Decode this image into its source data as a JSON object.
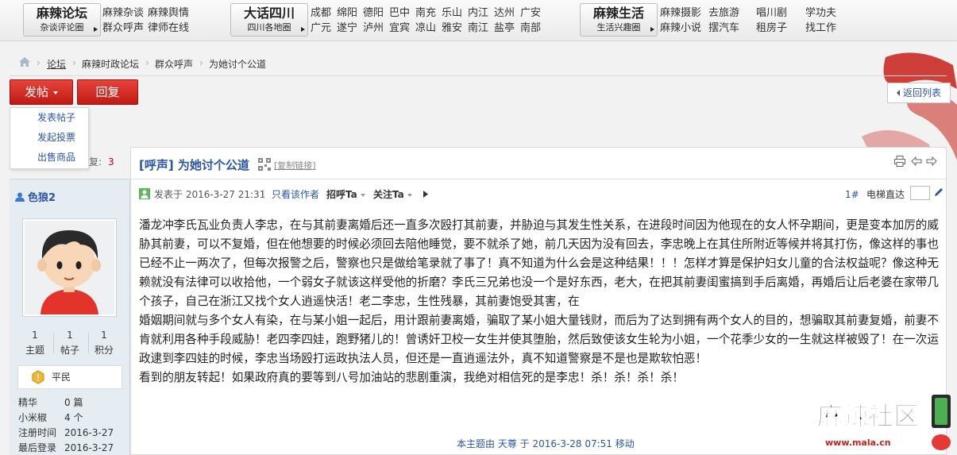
{
  "topnav": {
    "groups": [
      {
        "title": "麻辣论坛",
        "subtitle": "杂谈评论圈"
      },
      {
        "title": "大话四川",
        "subtitle": "四川各地圈"
      },
      {
        "title": "麻辣生活",
        "subtitle": "生活兴趣圈"
      }
    ],
    "links_forum": [
      [
        "麻辣杂谈",
        "麻辣舆情"
      ],
      [
        "群众呼声",
        "律师在线"
      ]
    ],
    "links_sichuan": [
      [
        "成都",
        "绵阳",
        "德阳",
        "巴中",
        "南充",
        "乐山",
        "内江",
        "达州",
        "广安"
      ],
      [
        "广元",
        "遂宁",
        "泸州",
        "宜宾",
        "凉山",
        "雅安",
        "南江",
        "盐亭",
        "南部"
      ]
    ],
    "links_life": [
      [
        "麻辣摄影",
        "去旅游",
        "唱川剧",
        "学功夫"
      ],
      [
        "麻辣小说",
        "摆汽车",
        "租房子",
        "找工作"
      ]
    ]
  },
  "breadcrumb": [
    "论坛",
    "麻辣时政论坛",
    "群众呼声",
    "为她讨个公道"
  ],
  "actions": {
    "post_label": "发帖",
    "reply_label": "回复",
    "back_label": "返回列表",
    "post_menu": [
      "发表帖子",
      "发起投票",
      "出售商品"
    ]
  },
  "replies_peek": {
    "label": "复:",
    "count": "3"
  },
  "user": {
    "name": "色狼2",
    "stats": [
      {
        "value": "1",
        "label": "主题"
      },
      {
        "value": "1",
        "label": "帖子"
      },
      {
        "value": "1",
        "label": "积分"
      }
    ],
    "rank": "平民",
    "info": [
      {
        "k": "精华",
        "v": "0 篇"
      },
      {
        "k": "小米椒",
        "v": "4 个"
      },
      {
        "k": "注册时间",
        "v": "2016-3-27"
      },
      {
        "k": "最后登录",
        "v": "2016-3-27"
      }
    ]
  },
  "post": {
    "title": "[呼声] 为她讨个公道",
    "copy_link": "[复制链接]",
    "posted_at": "发表于 2016-3-27 21:31",
    "only_author": "只看该作者",
    "greet": "招呼Ta",
    "follow": "关注Ta",
    "floor": "1#",
    "jump_label": "电梯直达",
    "paragraphs": [
      "潘龙冲李氏瓦业负责人李忠，在与其前妻离婚后还一直多次殴打其前妻，并胁迫与其发生性关系，在进段时间因为他现在的女人怀孕期间，更是变本加厉的威胁其前妻，可以不复婚，但在他想要的时候必须回去陪他睡觉，要不就杀了她，前几天因为没有回去，李忠晚上在其住所附近等候并将其打伤，像这样的事也已经不止一两次了，但每次报警之后，警察也只是做给笔录就了事了！真不知道为什么会是这种结果！！！怎样才算是保护妇女儿童的合法权益呢？像这种无赖就没有法律可以收拾他，一个弱女子就该这样受他的折磨？李氏三兄弟也没一个是好东西，老大，在把其前妻闺蜜搞到手后离婚，再婚后让后老婆在家带几个孩子，自己在浙江又找个女人逍遥快活！老二李忠，生性残暴，其前妻饱受其害，在",
      "婚姻期间就与多个女人有染，在与某小姐一起后，用计跟前妻离婚，骗取了某小姐大量钱财，而后为了达到拥有两个女人的目的，想骗取其前妻复婚，前妻不肯就利用各种手段威胁！老四李四娃，跑野猪儿的！曾诱奸卫校一女生并使其堕胎，然后致使该女生轮为小姐，一个花季少女的一生就这样被毁了！在一次运政逮到李四娃的时候，李忠当场殴打运政执法人员，但还是一直逍遥法外，真不知道警察是不是也是欺软怕恶！",
      "看到的朋友转起！如果政府真的要等到八号加油站的悲剧重演，我绝对相信死的是李忠！杀！杀！杀！杀！"
    ],
    "moved_note": "本主题由 天尊 于 2016-3-28 07:51 移动"
  },
  "watermark": {
    "brand": "麻辣社区",
    "url": "www.mala.cn"
  },
  "colors": {
    "accent_red": "#c8201a",
    "link_blue": "#2a55a4"
  }
}
